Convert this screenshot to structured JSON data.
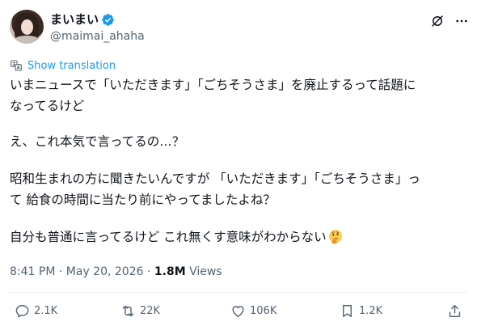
{
  "author": {
    "display_name": "まいまい",
    "handle": "@maimai_ahaha",
    "verified_color": "#1d9bf0"
  },
  "translation": {
    "label": "Show translation",
    "icon": "translate-icon"
  },
  "post": {
    "line1": "いまニュースで「いただきます」「ごちそうさま」を廃止するって話題に",
    "line2": "なってるけど",
    "line3": "え、これ本気で言ってるの…？",
    "line4": "昭和生まれの方に聞きたいんですが 「いただきます」「ごちそうさま」っ",
    "line5": "て 給食の時間に当たり前にやってましたよね？",
    "line6": "自分も普通に言ってるけど これ無くす意味がわからない",
    "emoji": "thinking-face-emoji"
  },
  "meta": {
    "time": "8:41 PM",
    "separator": " · ",
    "date": "May 20, 2026",
    "views_count": "1.8M",
    "views_label": " Views"
  },
  "actions": {
    "replies": "2.1K",
    "reposts": "22K",
    "likes": "106K",
    "bookmarks": "1.2K"
  },
  "colors": {
    "text": "#0f1419",
    "secondary": "#536471",
    "link": "#1d9bf0",
    "divider": "#eff3f4"
  }
}
